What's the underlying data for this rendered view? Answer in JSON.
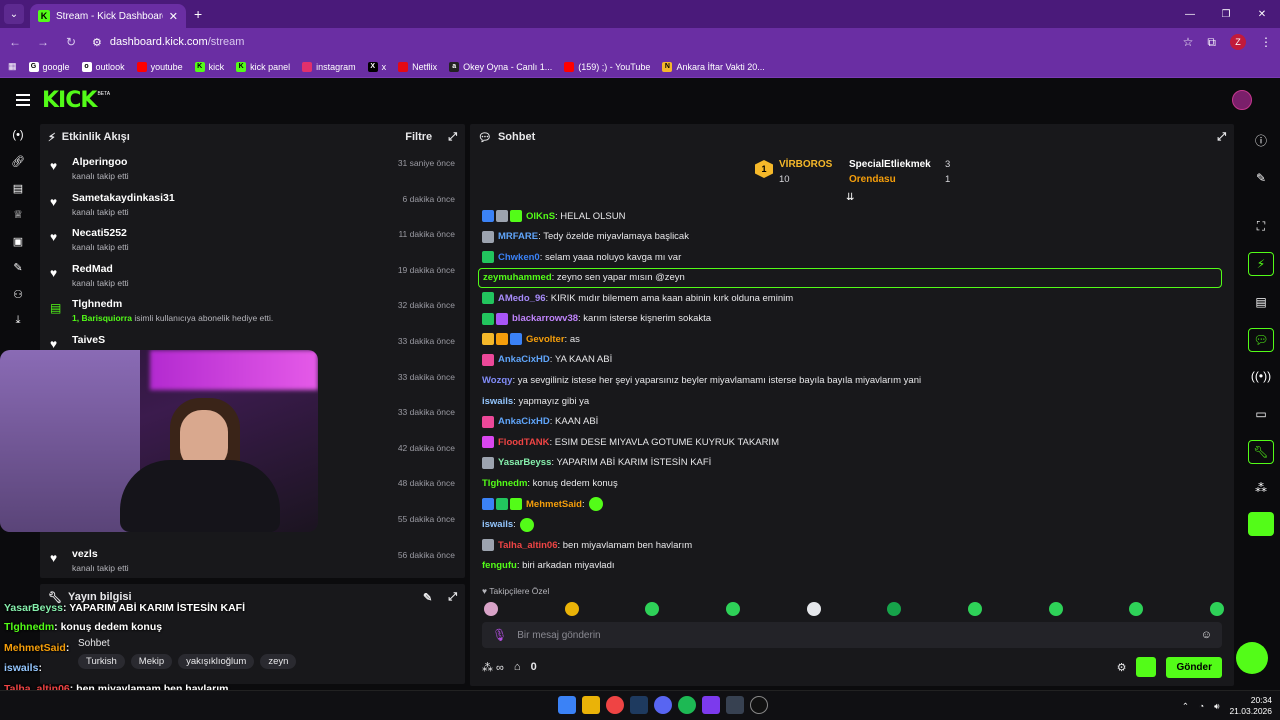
{
  "browser": {
    "tab_title": "Stream - Kick Dashboard",
    "url_host": "dashboard.kick.com",
    "url_path": "/stream",
    "profile_letter": "Z",
    "bookmarks": [
      "google",
      "outlook",
      "youtube",
      "kick",
      "kick panel",
      "instagram",
      "x",
      "Netflix",
      "Okey Oyna - Canlı 1...",
      "(159) ;) - YouTube",
      "Ankara İftar Vakti 20..."
    ]
  },
  "kick": {
    "logo": "KICK",
    "beta": "BETA"
  },
  "activity": {
    "title": "Etkinlik Akışı",
    "filter": "Filtre",
    "events": [
      {
        "name": "Alperingoo",
        "desc": "kanalı takip etti",
        "time": "31 saniye önce",
        "type": "follow"
      },
      {
        "name": "Sametakaydinkasi31",
        "desc": "kanalı takip etti",
        "time": "6 dakika önce",
        "type": "follow"
      },
      {
        "name": "Necati5252",
        "desc": "kanalı takip etti",
        "time": "11 dakika önce",
        "type": "follow"
      },
      {
        "name": "RedMad",
        "desc": "kanalı takip etti",
        "time": "19 dakika önce",
        "type": "follow"
      },
      {
        "name": "Tlghnedm",
        "desc_bold": "1, Barisquiorra",
        "desc": " isimli kullanıcıya abonelik hediye etti.",
        "time": "32 dakika önce",
        "type": "sub"
      },
      {
        "name": "TaiveS",
        "desc": "",
        "time": "33 dakika önce",
        "type": "follow"
      },
      {
        "name": "",
        "desc": "",
        "time": "33 dakika önce",
        "type": "follow"
      },
      {
        "name": "",
        "desc": "i kullanıcıya abonelik hediye etti.",
        "time": "33 dakika önce",
        "type": "sub"
      },
      {
        "name": "",
        "desc": "",
        "time": "42 dakika önce",
        "type": "follow"
      },
      {
        "name": "",
        "desc": "onelik hediye etti.",
        "time": "48 dakika önce",
        "type": "sub"
      },
      {
        "name": "",
        "desc": "kanalı takip etti",
        "time": "55 dakika önce",
        "type": "follow"
      },
      {
        "name": "vezls",
        "desc": "kanalı takip etti",
        "time": "56 dakika önce",
        "type": "follow"
      }
    ]
  },
  "stream_info": {
    "title": "Yayın bilgisi",
    "stream_title": "Sohbet",
    "category": "Sohbet",
    "tags": [
      "Turkish",
      "Mekip",
      "yakışıklıoğlum",
      "zeyn"
    ]
  },
  "chat": {
    "title": "Sohbet",
    "leaderboard": {
      "left_name": "VİRBOROS",
      "left_value": "10",
      "right": [
        {
          "name": "SpecialEtliekmek",
          "value": "3"
        },
        {
          "name": "Orendasu",
          "value": "1"
        }
      ]
    },
    "messages": [
      {
        "user": "OlKnS",
        "color": "#53fc18",
        "text": ": HELAL OLSUN",
        "badges": [
          "#3b82f6",
          "#9ca3af",
          "#53fc18"
        ]
      },
      {
        "user": "MRFARE",
        "color": "#60a5fa",
        "text": ": Tedy özelde miyavlamaya başlicak",
        "badges": [
          "#9ca3af"
        ]
      },
      {
        "user": "Chwken0",
        "color": "#3b82f6",
        "text": ": selam yaaa noluyo kavga mı var",
        "badges": [
          "#22c55e"
        ]
      },
      {
        "user": "zeymuhammed",
        "color": "#53fc18",
        "text": ": zeyno sen yapar mısın @zeyn",
        "badges": [],
        "highlight": true
      },
      {
        "user": "AMedo_96",
        "color": "#a78bfa",
        "text": ": KIRIK mıdır bilemem ama kaan abinin kırk olduna eminim",
        "badges": [
          "#22c55e"
        ]
      },
      {
        "user": "blackarrowv38",
        "color": "#c084fc",
        "text": ": karım isterse kişnerim sokakta",
        "badges": [
          "#22c55e",
          "#a855f7"
        ]
      },
      {
        "user": "Gevolter",
        "color": "#f59e0b",
        "text": ": as",
        "badges": [
          "#f5b82a",
          "#f59e0b",
          "#3b82f6"
        ]
      },
      {
        "user": "AnkaCixHD",
        "color": "#60a5fa",
        "text": ": YA KAAN ABİ",
        "badges": [
          "#ec4899"
        ]
      },
      {
        "user": "Wozqy",
        "color": "#818cf8",
        "text": ": ya sevgiliniz istese her şeyi yaparsınız beyler miyavlamamı isterse bayıla bayıla miyavlarım yani",
        "badges": []
      },
      {
        "user": "iswails",
        "color": "#93c5fd",
        "text": ": yapmayız gibi ya",
        "badges": []
      },
      {
        "user": "AnkaCixHD",
        "color": "#60a5fa",
        "text": ": KAAN ABİ",
        "badges": [
          "#ec4899"
        ]
      },
      {
        "user": "FloodTANK",
        "color": "#ef4444",
        "text": ": ESIM DESE MIYAVLA GOTUME KUYRUK TAKARIM",
        "badges": [
          "#d946ef"
        ]
      },
      {
        "user": "YasarBeyss",
        "color": "#86efac",
        "text": ": YAPARIM ABİ KARIM İSTESİN KAFİ",
        "badges": [
          "#9ca3af"
        ]
      },
      {
        "user": "Tlghnedm",
        "color": "#53fc18",
        "text": ": konuş dedem konuş",
        "badges": []
      },
      {
        "user": "MehmetSaid",
        "color": "#f59e0b",
        "text": ":",
        "badges": [
          "#3b82f6",
          "#22c55e",
          "#53fc18"
        ],
        "emote": true
      },
      {
        "user": "iswails",
        "color": "#93c5fd",
        "text": ":",
        "badges": [],
        "emote": true
      },
      {
        "user": "Talha_altin06",
        "color": "#ef4444",
        "text": ": ben miyavlamam ben havlarım",
        "badges": [
          "#9ca3af"
        ]
      },
      {
        "user": "fengufu",
        "color": "#53fc18",
        "text": ": biri arkadan miyavladı",
        "badges": []
      }
    ],
    "pinned_label": "Takipçilere Özel",
    "input_placeholder": "Bir mesaj gönderin",
    "viewer_count": "0",
    "send_label": "Gönder"
  },
  "overlay": {
    "lines": [
      {
        "user": "YasarBeyss",
        "text": ": YAPARIM ABİ KARIM İSTESİN KAFİ",
        "color": "#86efac"
      },
      {
        "user": "Tlghnedm",
        "text": ": konuş dedem konuş",
        "color": "#53fc18"
      },
      {
        "user": "MehmetSaid",
        "text": ":",
        "color": "#f59e0b"
      },
      {
        "user": "iswails",
        "text": ":",
        "color": "#93c5fd"
      },
      {
        "user": "Talha_altin06",
        "text": ": ben miyavlamam ben havlarım",
        "color": "#ef4444"
      },
      {
        "user": "fengufu",
        "text": ": biri arkadan miyavladı",
        "color": "#53fc18"
      }
    ]
  },
  "taskbar": {
    "time": "20:34",
    "date": "21.03.2026"
  }
}
